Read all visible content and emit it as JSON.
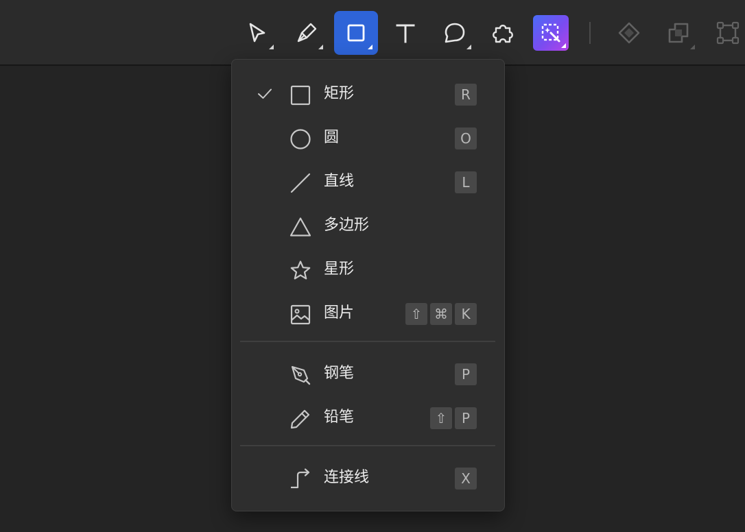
{
  "toolbar": {
    "tools": [
      {
        "name": "select-tool",
        "icon": "cursor-arrow-icon",
        "active": false,
        "has_submenu": true
      },
      {
        "name": "pen-tool",
        "icon": "pen-nib-icon",
        "active": false,
        "has_submenu": true
      },
      {
        "name": "shape-tool",
        "icon": "square-icon",
        "active": true,
        "has_submenu": true
      },
      {
        "name": "text-tool",
        "icon": "text-t-icon",
        "active": false,
        "has_submenu": false
      },
      {
        "name": "comment-tool",
        "icon": "speech-bubble-icon",
        "active": false,
        "has_submenu": true
      },
      {
        "name": "plugin-tool",
        "icon": "puzzle-piece-icon",
        "active": false,
        "has_submenu": false
      },
      {
        "name": "ai-tool",
        "icon": "ai-magic-wand-icon",
        "active": false,
        "has_submenu": true
      },
      {
        "name": "component-tool",
        "icon": "diamond-icon",
        "active": false,
        "has_submenu": false
      },
      {
        "name": "boolean-tool",
        "icon": "boolean-union-icon",
        "active": false,
        "has_submenu": true
      },
      {
        "name": "frame-edit-tool",
        "icon": "vector-path-icon",
        "active": false,
        "has_submenu": false
      }
    ],
    "accent_color": "#2e64d8"
  },
  "menu": {
    "items": [
      {
        "label": "矩形",
        "icon": "rectangle-icon",
        "checked": true,
        "keys": [
          "R"
        ]
      },
      {
        "label": "圆",
        "icon": "circle-icon",
        "checked": false,
        "keys": [
          "O"
        ]
      },
      {
        "label": "直线",
        "icon": "line-icon",
        "checked": false,
        "keys": [
          "L"
        ]
      },
      {
        "label": "多边形",
        "icon": "triangle-icon",
        "checked": false,
        "keys": []
      },
      {
        "label": "星形",
        "icon": "star-icon",
        "checked": false,
        "keys": []
      },
      {
        "label": "图片",
        "icon": "image-icon",
        "checked": false,
        "keys": [
          "⇧",
          "⌘",
          "K"
        ]
      },
      {
        "label": "钢笔",
        "icon": "pen-icon",
        "checked": false,
        "keys": [
          "P"
        ]
      },
      {
        "label": "铅笔",
        "icon": "pencil-icon",
        "checked": false,
        "keys": [
          "⇧",
          "P"
        ]
      },
      {
        "label": "连接线",
        "icon": "connector-icon",
        "checked": false,
        "keys": [
          "X"
        ]
      }
    ]
  }
}
